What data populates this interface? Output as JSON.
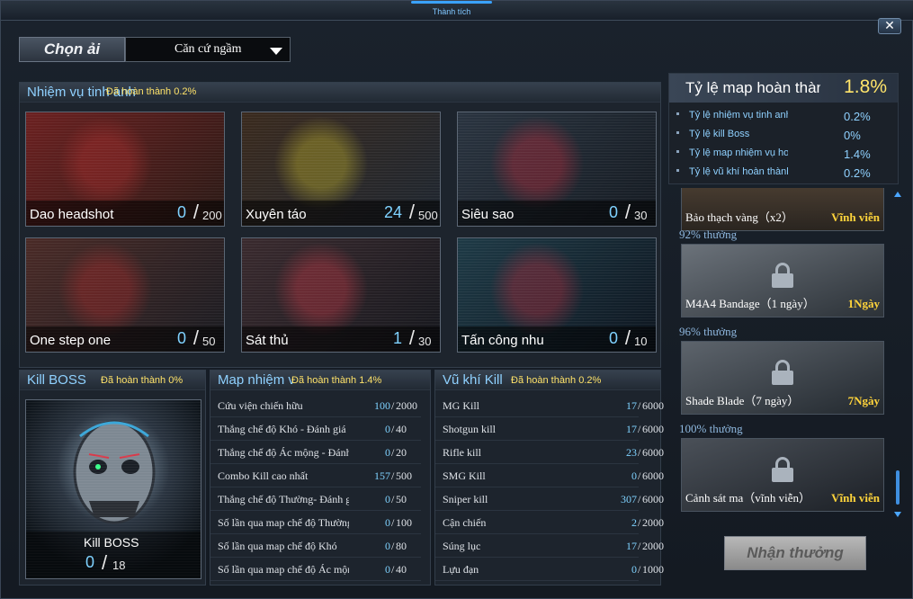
{
  "top_tab": {
    "label": "Thành tích"
  },
  "chapter_select": {
    "label": "Chọn ải",
    "value": "Căn cứ ngầm"
  },
  "elite_missions": {
    "title": "Nhiệm vụ tinh anh",
    "progress": "Đã hoàn thành 0.2%",
    "cards": [
      {
        "name": "Dao headshot",
        "current": "0",
        "total": "200",
        "palette": [
          "#6b2020",
          "#2a1a16",
          "#c23030"
        ]
      },
      {
        "name": "Xuyên táo",
        "current": "24",
        "total": "500",
        "palette": [
          "#3a2a1e",
          "#1e2630",
          "#e0d02a"
        ]
      },
      {
        "name": "Siêu sao",
        "current": "0",
        "total": "30",
        "palette": [
          "#2a3440",
          "#151b22",
          "#d8283a"
        ]
      },
      {
        "name": "One step one",
        "current": "0",
        "total": "50",
        "palette": [
          "#4a2a26",
          "#1a1c22",
          "#c02a2a"
        ]
      },
      {
        "name": "Sát thủ",
        "current": "1",
        "total": "30",
        "palette": [
          "#3a2a2e",
          "#16181e",
          "#e23a4a"
        ]
      },
      {
        "name": "Tấn công nhu",
        "current": "0",
        "total": "10",
        "palette": [
          "#1e3a46",
          "#0e1620",
          "#d0283a"
        ]
      }
    ]
  },
  "kill_boss": {
    "title": "Kill BOSS",
    "progress": "Đã hoàn thành 0%",
    "name": "Kill BOSS",
    "current": "0",
    "total": "18"
  },
  "map_missions": {
    "title": "Map nhiệm vụ",
    "progress": "Đã hoàn thành 1.4%",
    "rows": [
      {
        "name": "Cứu viện chiến hữu",
        "current": "100",
        "total": "2000"
      },
      {
        "name": "Thắng chế độ Khó - Đánh giá",
        "current": "0",
        "total": "40"
      },
      {
        "name": "Thắng chế độ Ác mộng - Đánh",
        "current": "0",
        "total": "20"
      },
      {
        "name": "Combo Kill cao nhất",
        "current": "157",
        "total": "500"
      },
      {
        "name": "Thắng chế độ Thường- Đánh giá",
        "current": "0",
        "total": "50"
      },
      {
        "name": "Số lần qua map chế độ Thường",
        "current": "0",
        "total": "100"
      },
      {
        "name": "Số lần qua map chế độ Khó",
        "current": "0",
        "total": "80"
      },
      {
        "name": "Số lần qua map chế độ Ác mộng",
        "current": "0",
        "total": "40"
      }
    ]
  },
  "weapon_kills": {
    "title": "Vũ khí Kill",
    "progress": "Đã hoàn thành 0.2%",
    "rows": [
      {
        "name": "MG Kill",
        "current": "17",
        "total": "6000"
      },
      {
        "name": "Shotgun kill",
        "current": "17",
        "total": "6000"
      },
      {
        "name": "Rifle kill",
        "current": "23",
        "total": "6000"
      },
      {
        "name": "SMG Kill",
        "current": "0",
        "total": "6000"
      },
      {
        "name": "Sniper kill",
        "current": "307",
        "total": "6000"
      },
      {
        "name": "Cận chiến",
        "current": "2",
        "total": "2000"
      },
      {
        "name": "Súng lục",
        "current": "17",
        "total": "2000"
      },
      {
        "name": "Lựu đạn",
        "current": "0",
        "total": "1000"
      }
    ]
  },
  "completion_rate": {
    "title": "Tỷ lệ map hoàn thành",
    "value": "1.8%",
    "rows": [
      {
        "label": "Tỷ lệ nhiệm vụ tinh anh",
        "value": "0.2%"
      },
      {
        "label": "Tỷ lệ kill Boss",
        "value": "0%"
      },
      {
        "label": "Tỷ lệ map nhiệm vụ hoàn thành",
        "value": "1.4%"
      },
      {
        "label": "Tỷ lệ vũ khí hoàn thành",
        "value": "0.2%"
      }
    ]
  },
  "rewards": [
    {
      "percent": "",
      "name": "Bảo thạch vàng（x2）",
      "duration": "Vĩnh viễn"
    },
    {
      "percent": "92% thưởng",
      "name": "M4A4 Bandage（1 ngày）",
      "duration": "1Ngày"
    },
    {
      "percent": "96% thưởng",
      "name": "Shade Blade（7 ngày）",
      "duration": "7Ngày"
    },
    {
      "percent": "100% thưởng",
      "name": "Cảnh sát ma（vĩnh viễn）",
      "duration": "Vĩnh viễn"
    }
  ],
  "claim_button": {
    "label": "Nhận thưởng"
  },
  "close_icon": "close-icon",
  "colors": {
    "accent": "#7fd2ff",
    "progress": "#ffe36a",
    "reward": "#ffd43b"
  }
}
